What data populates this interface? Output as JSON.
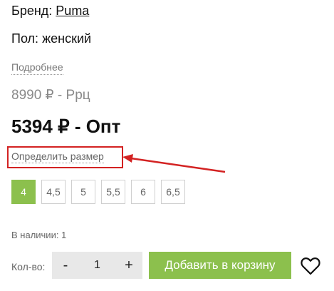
{
  "product": {
    "brand_label": "Бренд:",
    "brand_value": "Puma",
    "gender_label": "Пол:",
    "gender_value": "женский",
    "more_link": "Подробнее",
    "rrc_price": "8990 ₽ - Ррц",
    "opt_price": "5394 ₽ - Опт",
    "size_link": "Определить размер",
    "sizes": [
      "4",
      "4,5",
      "5",
      "5,5",
      "6",
      "6,5"
    ],
    "selected_size": "4",
    "stock": "В наличии: 1"
  },
  "cart": {
    "qty_label": "Кол-во:",
    "minus": "-",
    "plus": "+",
    "qty_value": "1",
    "add_button": "Добавить в корзину"
  },
  "icons": {
    "wishlist": "heart-icon",
    "annotation": "arrow-icon"
  },
  "colors": {
    "accent": "#8cc04d",
    "highlight": "#d32222"
  }
}
